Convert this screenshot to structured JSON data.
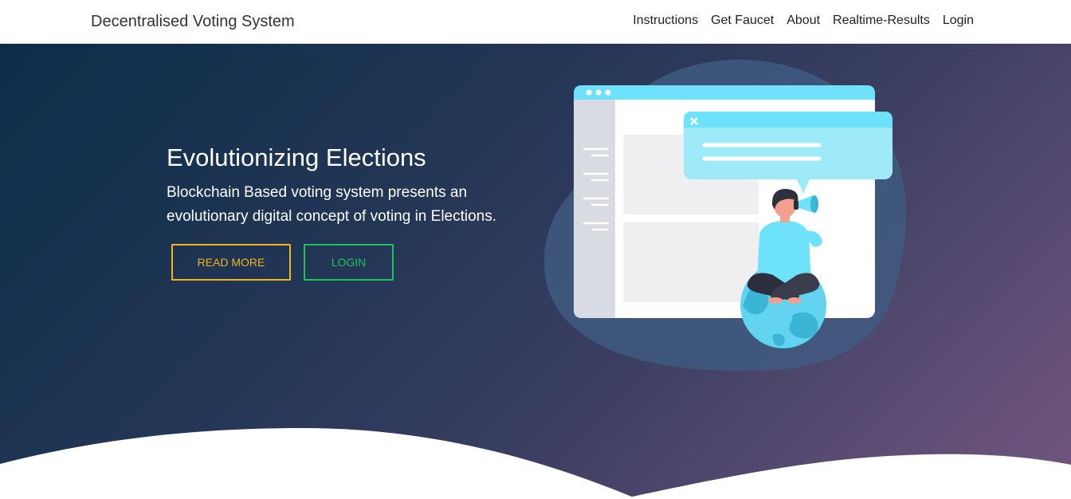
{
  "navbar": {
    "brand": "Decentralised Voting System",
    "links": [
      "Instructions",
      "Get Faucet",
      "About",
      "Realtime-Results",
      "Login"
    ]
  },
  "hero": {
    "title": "Evolutionizing Elections",
    "subtitle": "Blockchain Based voting system presents an evolutionary digital concept of voting in Elections.",
    "buttons": {
      "read_more": "READ MORE",
      "login": "LOGIN"
    }
  },
  "colors": {
    "gradient_start": "#0b2e4a",
    "gradient_end": "#73567f",
    "read_more_accent": "#f4b41a",
    "login_accent": "#1fc25a",
    "illustration_cyan": "#6ee2fa"
  },
  "icons": [
    "close-icon",
    "megaphone-icon",
    "globe-icon",
    "menu-lines-icon"
  ]
}
